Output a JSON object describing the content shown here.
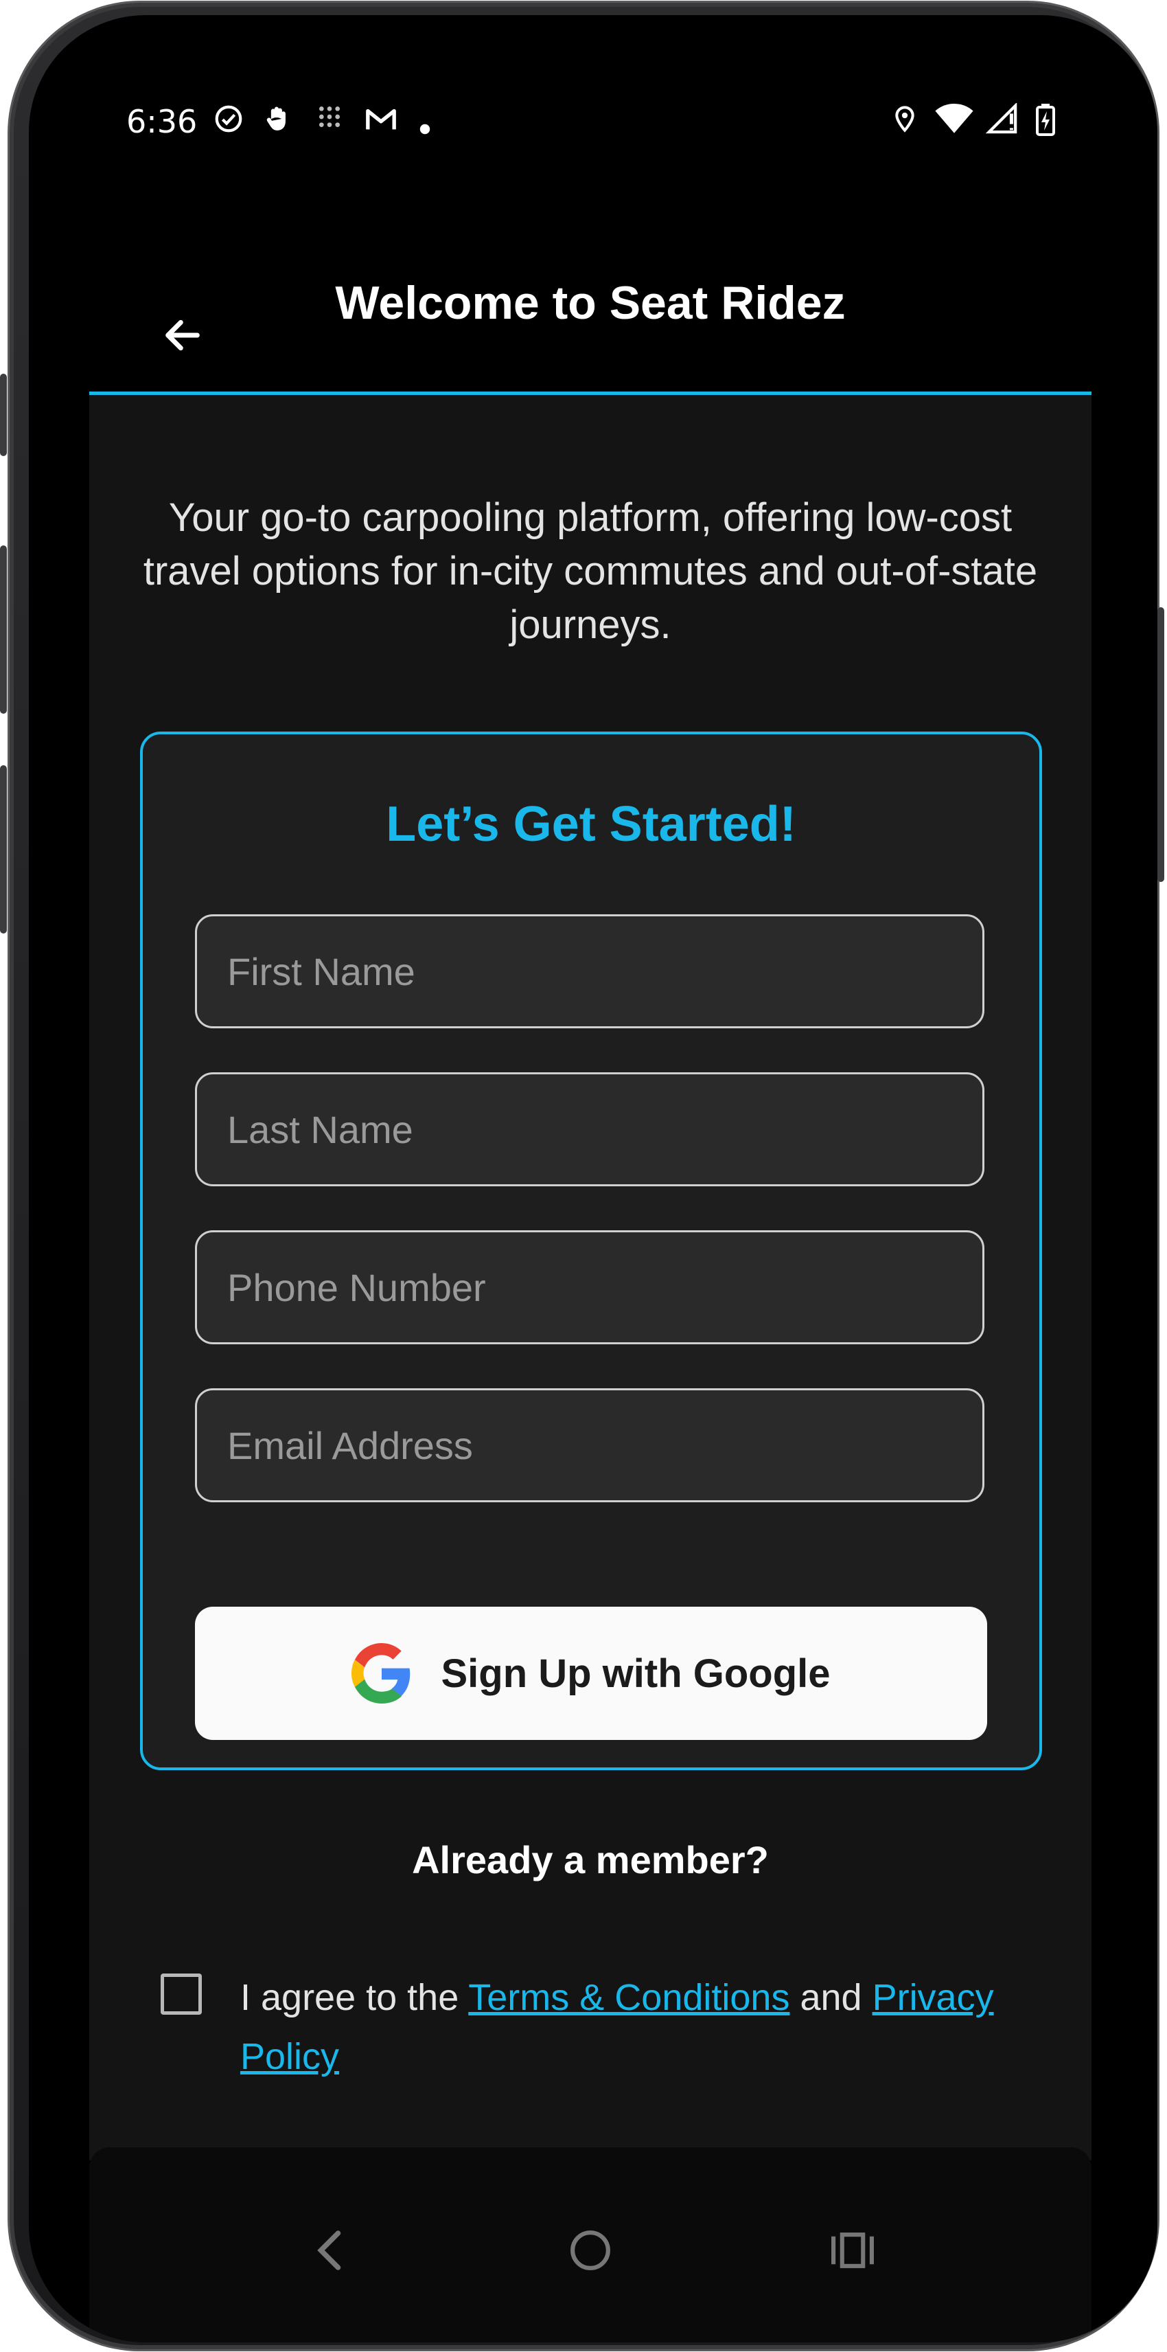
{
  "status_bar": {
    "time": "6:36"
  },
  "header": {
    "title": "Welcome to Seat Ridez"
  },
  "tagline": "Your go-to carpooling platform, offering low-cost travel options for in-city commutes and out-of-state journeys.",
  "form": {
    "title": "Let’s Get Started!",
    "first_name_placeholder": "First Name",
    "last_name_placeholder": "Last Name",
    "phone_placeholder": "Phone Number",
    "email_placeholder": "Email Address",
    "google_button_label": "Sign Up with Google"
  },
  "already_member": "Already a member?",
  "agreement": {
    "prefix": "I agree to the ",
    "terms_link": "Terms & Conditions",
    "middle": " and ",
    "privacy_link": "Privacy Policy"
  },
  "colors": {
    "accent": "#1ab7ea",
    "background": "#141414",
    "card": "#1e1e1e"
  }
}
